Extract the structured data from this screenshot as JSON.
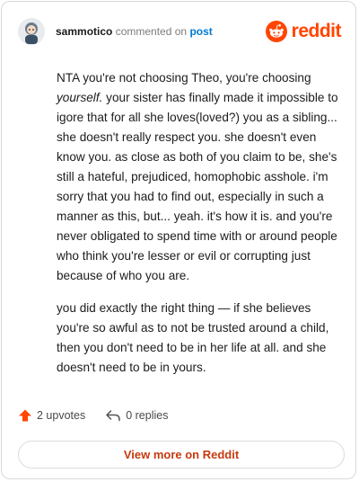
{
  "header": {
    "username": "sammotico",
    "action_text": "commented on",
    "post_link": "post",
    "brand": "reddit"
  },
  "comment": {
    "p1_a": "NTA you're not choosing Theo, you're choosing ",
    "p1_em": "yourself.",
    "p1_b": " your sister has finally made it impossible to igore that for all she loves(loved?) you as a sibling... she doesn't really respect you. she doesn't even know you. as close as both of you claim to be, she's still a hateful, prejudiced, homophobic asshole. i'm sorry that you had to find out, especially in such a manner as this, but... yeah. it's how it is. and you're never obligated to spend time with or around people who think you're lesser or evil or corrupting just because of who you are.",
    "p2": "you did exactly the right thing — if she believes you're so awful as to not be trusted around a child, then you don't need to be in her life at all. and she doesn't need to be in yours."
  },
  "actions": {
    "upvotes": "2 upvotes",
    "replies": "0 replies"
  },
  "footer": {
    "view_more": "View more on Reddit"
  },
  "colors": {
    "brand": "#ff4500",
    "link": "#0079d3",
    "view_more": "#c63a0f"
  }
}
